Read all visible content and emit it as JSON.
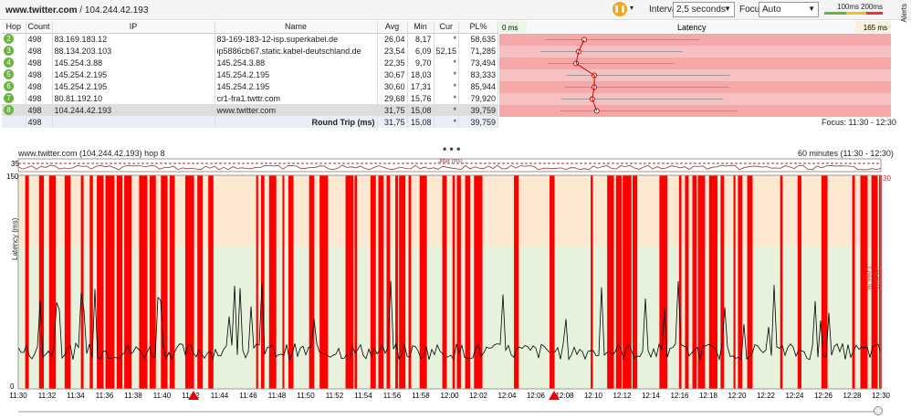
{
  "header": {
    "target_host": "www.twitter.com",
    "target_ip": "104.244.42.193"
  },
  "toolbar": {
    "interval_label": "Interval",
    "interval_value": "2,5 seconds",
    "focus_label": "Focus",
    "focus_value": "Auto",
    "scale_100": "100ms",
    "scale_200": "200ms",
    "alerts": "Alerts"
  },
  "table": {
    "columns": [
      "Hop",
      "Count",
      "IP",
      "Name",
      "Avg",
      "Min",
      "Cur",
      "PL%"
    ],
    "rows": [
      {
        "hop": "2",
        "count": "498",
        "ip": "83.169.183.12",
        "name": "83-169-183-12-isp.superkabel.de",
        "avg": "26,04",
        "min": "8,17",
        "cur": "*",
        "pl": "58,635"
      },
      {
        "hop": "3",
        "count": "498",
        "ip": "88.134.203.103",
        "name": "ip5886cb67.static.kabel-deutschland.de",
        "avg": "23,54",
        "min": "6,09",
        "cur": "52,15",
        "pl": "71,285"
      },
      {
        "hop": "4",
        "count": "498",
        "ip": "145.254.3.88",
        "name": "145.254.3.88",
        "avg": "22,35",
        "min": "9,70",
        "cur": "*",
        "pl": "73,494"
      },
      {
        "hop": "5",
        "count": "498",
        "ip": "145.254.2.195",
        "name": "145.254.2.195",
        "avg": "30,67",
        "min": "18,03",
        "cur": "*",
        "pl": "83,333"
      },
      {
        "hop": "6",
        "count": "498",
        "ip": "145.254.2.195",
        "name": "145.254.2.195",
        "avg": "30,60",
        "min": "17,31",
        "cur": "*",
        "pl": "85,944"
      },
      {
        "hop": "7",
        "count": "498",
        "ip": "80.81.192.10",
        "name": "cr1-fra1.twttr.com",
        "avg": "29,68",
        "min": "15,76",
        "cur": "*",
        "pl": "79,920"
      },
      {
        "hop": "8",
        "count": "498",
        "ip": "104.244.42.193",
        "name": "www.twitter.com",
        "avg": "31,75",
        "min": "15,08",
        "cur": "*",
        "pl": "39,759"
      }
    ],
    "total": {
      "count": "498",
      "label": "Round Trip (ms)",
      "avg": "31,75",
      "min": "15,08",
      "cur": "*",
      "pl": "39,759"
    }
  },
  "latency_panel": {
    "title": "Latency",
    "left_label": "0 ms",
    "right_label": "165 ms",
    "focus_text": "Focus: 11:30 - 12:30"
  },
  "graph": {
    "title": "www.twitter.com (104.244.42.193) hop 8",
    "range": "60 minutes (11:30 - 12:30)",
    "ylabel": "Latency (ms)",
    "y2label": "Packet Loss %",
    "jitter_label": "Jitter (ms)",
    "jitter_max": "35",
    "ytick_top": "150",
    "ytick_zero": "0",
    "y2tick_top": "30",
    "time_ticks": [
      "11:30",
      "11:32",
      "11:34",
      "11:36",
      "11:38",
      "11:40",
      "11:42",
      "11:44",
      "11:46",
      "11:48",
      "11:50",
      "11:52",
      "11:54",
      "11:56",
      "11:58",
      "12:00",
      "12:02",
      "12:04",
      "12:06",
      "12:08",
      "12:10",
      "12:12",
      "12:14",
      "12:16",
      "12:18",
      "12:20",
      "12:22",
      "12:24",
      "12:26",
      "12:28",
      "12:30"
    ]
  },
  "colors": {
    "loss": "#ff0000",
    "green_zone": "#e6f2dc",
    "orange_zone": "#fde8d2",
    "hop_badge": "#6ab43e",
    "accent": "#f3a51a"
  }
}
